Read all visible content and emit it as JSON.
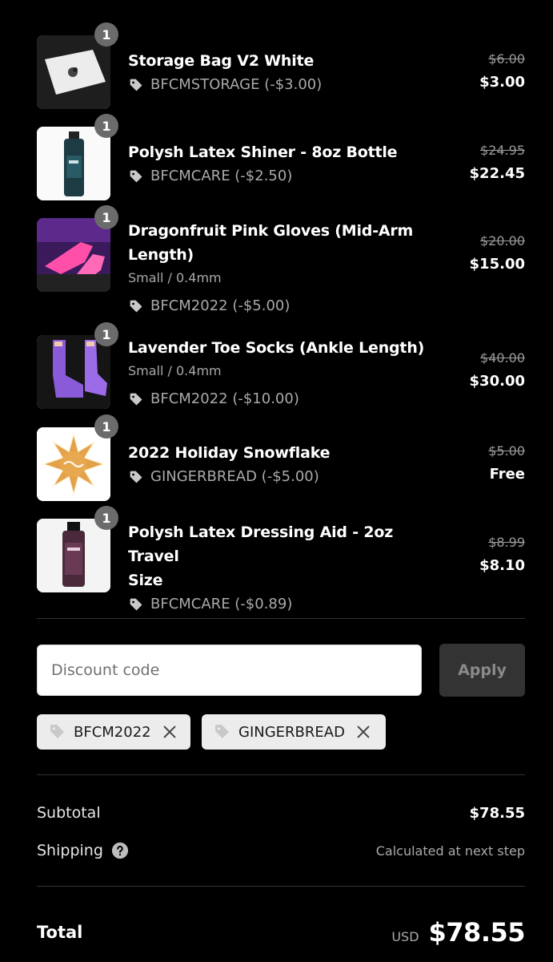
{
  "items": [
    {
      "quantity": "1",
      "name_lines": [
        "Storage Bag V2 White"
      ],
      "variant": "",
      "discount": "BFCMSTORAGE (-$3.00)",
      "original_price": "$6.00",
      "final_price": "$3.00",
      "image": "storage-bag-image"
    },
    {
      "quantity": "1",
      "name_lines": [
        "Polysh Latex Shiner - 8oz Bottle"
      ],
      "variant": "",
      "discount": "BFCMCARE (-$2.50)",
      "original_price": "$24.95",
      "final_price": "$22.45",
      "image": "shiner-bottle-image"
    },
    {
      "quantity": "1",
      "name_lines": [
        "Dragonfruit Pink Gloves (Mid-Arm",
        "Length)"
      ],
      "variant": "Small / 0.4mm",
      "discount": "BFCM2022 (-$5.00)",
      "original_price": "$20.00",
      "final_price": "$15.00",
      "image": "pink-gloves-image"
    },
    {
      "quantity": "1",
      "name_lines": [
        "Lavender Toe Socks (Ankle Length)"
      ],
      "variant": "Small / 0.4mm",
      "discount": "BFCM2022 (-$10.00)",
      "original_price": "$40.00",
      "final_price": "$30.00",
      "image": "toe-socks-image"
    },
    {
      "quantity": "1",
      "name_lines": [
        "2022 Holiday Snowflake"
      ],
      "variant": "",
      "discount": "GINGERBREAD (-$5.00)",
      "original_price": "$5.00",
      "final_price": "Free",
      "image": "snowflake-cookie-image"
    },
    {
      "quantity": "1",
      "name_lines": [
        "Polysh Latex Dressing Aid - 2oz Travel",
        "Size"
      ],
      "variant": "",
      "discount": "BFCMCARE (-$0.89)",
      "original_price": "$8.99",
      "final_price": "$8.10",
      "image": "dressing-aid-bottle-image"
    }
  ],
  "discount_form": {
    "placeholder": "Discount code",
    "value": "",
    "apply_label": "Apply"
  },
  "applied_codes": [
    "BFCM2022",
    "GINGERBREAD"
  ],
  "summary": {
    "subtotal_label": "Subtotal",
    "subtotal_value": "$78.55",
    "shipping_label": "Shipping",
    "shipping_value": "Calculated at next step",
    "total_label": "Total",
    "currency": "USD",
    "total_value": "$78.55"
  },
  "colors": {
    "background": "#000000",
    "badge": "#6b6b6b",
    "muted_text": "#a9a9a9",
    "chip_bg": "#ececec",
    "apply_bg": "#333333"
  }
}
